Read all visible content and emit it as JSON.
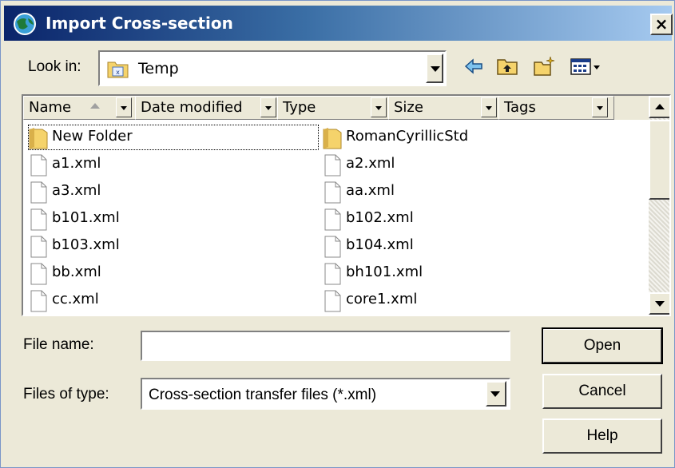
{
  "window": {
    "title": "Import Cross-section",
    "close_label": "×"
  },
  "lookin": {
    "label": "Look in:",
    "value": "Temp"
  },
  "toolbar": {
    "icons": [
      "back-arrow-icon",
      "up-one-level-icon",
      "new-folder-icon",
      "view-menu-icon"
    ]
  },
  "columns": [
    {
      "label": "Name"
    },
    {
      "label": "Date modified"
    },
    {
      "label": "Type"
    },
    {
      "label": "Size"
    },
    {
      "label": "Tags"
    }
  ],
  "files": {
    "left": [
      "New Folder",
      "a1.xml",
      "a3.xml",
      "b101.xml",
      "b103.xml",
      "bb.xml",
      "cc.xml"
    ],
    "right": [
      "RomanCyrillicStd",
      "a2.xml",
      "aa.xml",
      "b102.xml",
      "b104.xml",
      "bh101.xml",
      "core1.xml"
    ]
  },
  "form": {
    "filename_label": "File name:",
    "filename_value": "",
    "filetype_label": "Files of type:",
    "filetype_value": "Cross-section transfer files (*.xml)"
  },
  "buttons": {
    "open": "Open",
    "cancel": "Cancel",
    "help": "Help"
  },
  "colors": {
    "title_start": "#0a246a",
    "title_end": "#a6caf0",
    "face": "#ece9d8",
    "folder": "#f5d36b"
  }
}
